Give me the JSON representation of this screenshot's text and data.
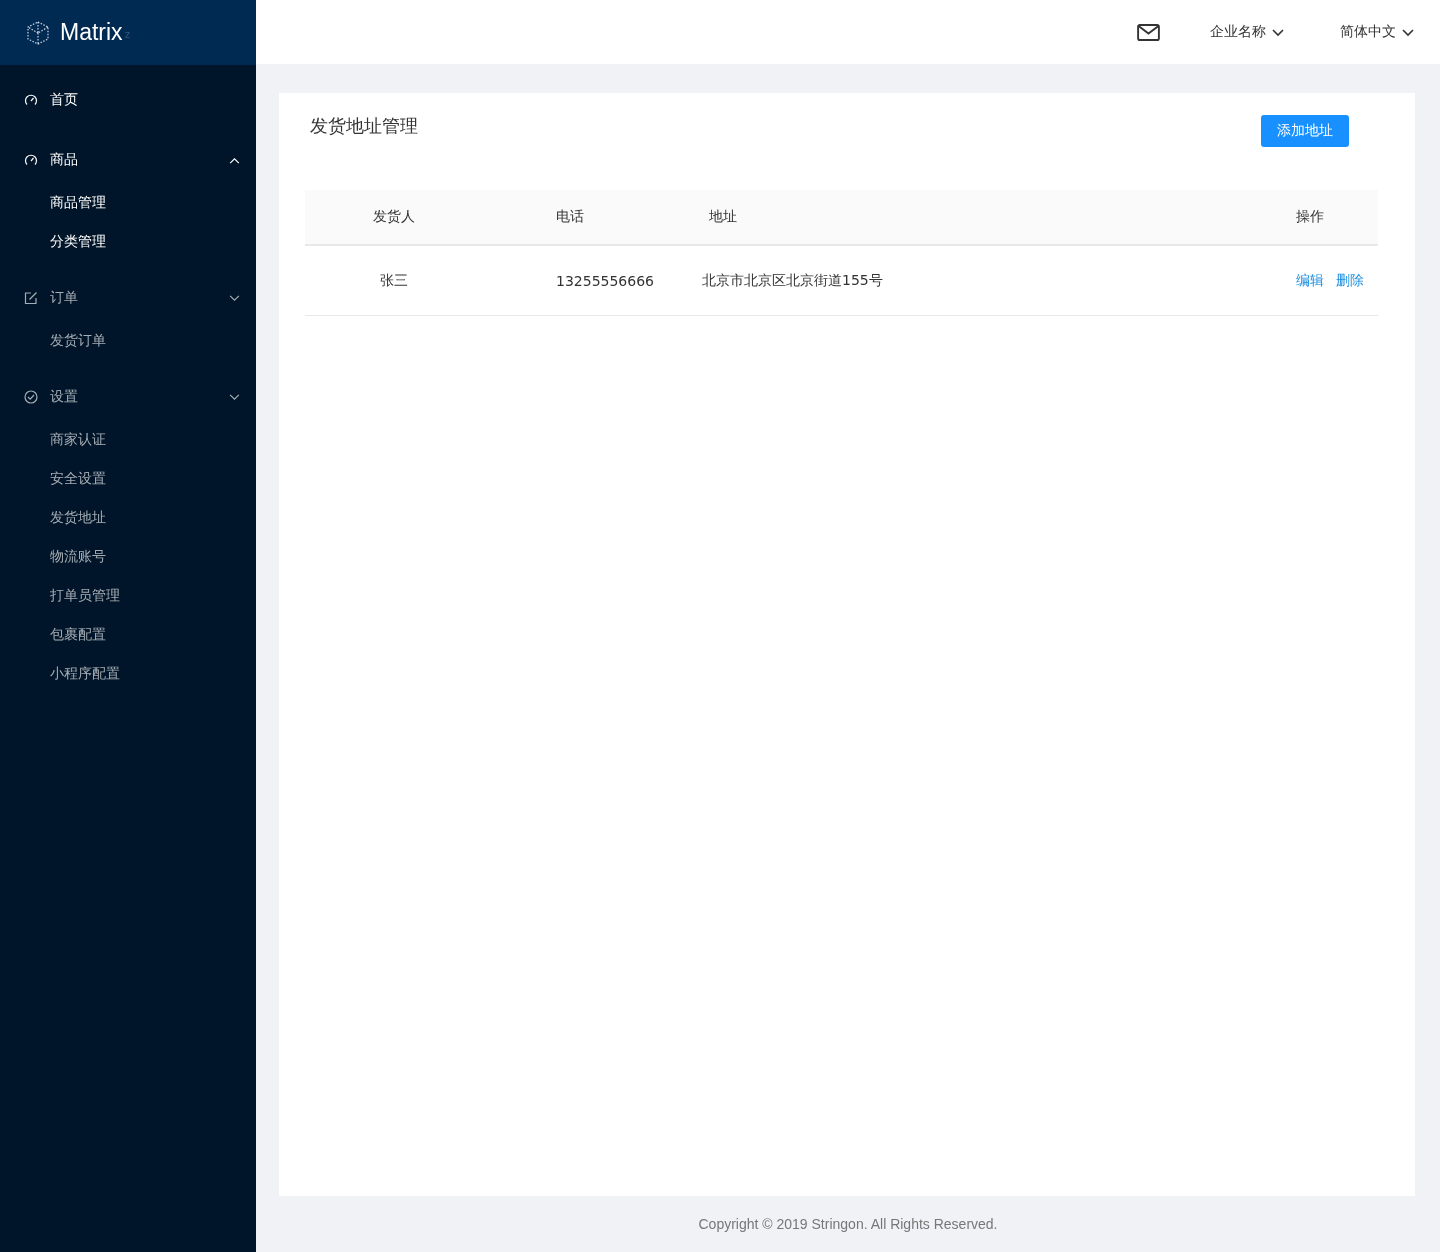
{
  "logo": {
    "name": "Matrix",
    "suffix": "z"
  },
  "sidebar": {
    "groups": [
      {
        "label": "首页",
        "active": true,
        "kind": "link"
      },
      {
        "label": "商品",
        "active": true,
        "kind": "group",
        "expanded": true,
        "children": [
          {
            "label": "商品管理",
            "active": true
          },
          {
            "label": "分类管理",
            "active": true
          }
        ]
      },
      {
        "label": "订单",
        "active": false,
        "kind": "group",
        "expanded": false,
        "children": [
          {
            "label": "发货订单",
            "active": false
          }
        ]
      },
      {
        "label": "设置",
        "active": false,
        "kind": "group",
        "expanded": false,
        "children": [
          {
            "label": "商家认证",
            "active": false
          },
          {
            "label": "安全设置",
            "active": false
          },
          {
            "label": "发货地址",
            "active": false
          },
          {
            "label": "物流账号",
            "active": false
          },
          {
            "label": "打单员管理",
            "active": false
          },
          {
            "label": "包裹配置",
            "active": false
          },
          {
            "label": "小程序配置",
            "active": false
          }
        ]
      }
    ]
  },
  "header": {
    "company": "企业名称",
    "language": "简体中文"
  },
  "page": {
    "title": "发货地址管理",
    "add_button": "添加地址"
  },
  "table": {
    "columns": [
      "发货人",
      "电话",
      "地址",
      "操作"
    ],
    "rows": [
      {
        "cells": [
          "张三",
          "13255556666",
          "北京市北京区北京街道155号"
        ],
        "actions": [
          "编辑",
          "删除"
        ]
      }
    ]
  },
  "footer": "Copyright © 2019 Stringon. All Rights Reserved."
}
